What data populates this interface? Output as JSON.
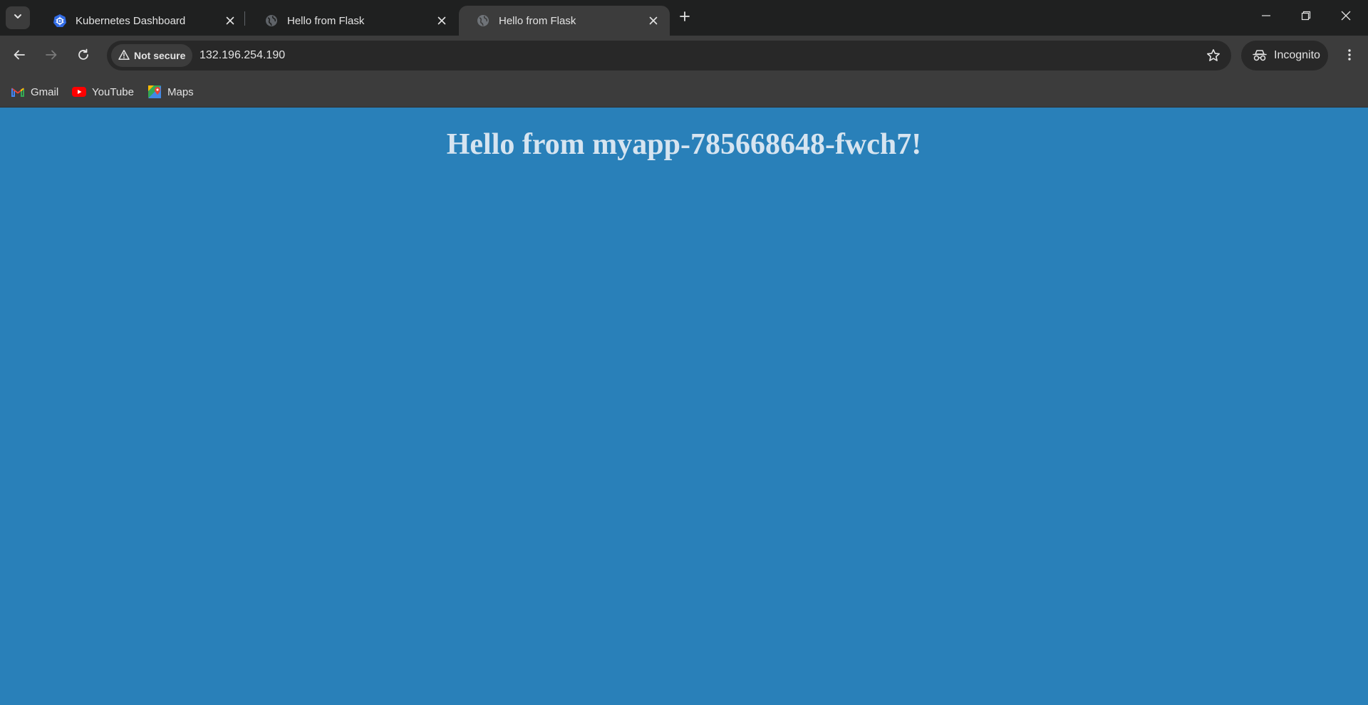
{
  "browser": {
    "tabs": [
      {
        "title": "Kubernetes Dashboard",
        "favicon": "kubernetes-icon",
        "active": false
      },
      {
        "title": "Hello from Flask",
        "favicon": "globe-icon",
        "active": false
      },
      {
        "title": "Hello from Flask",
        "favicon": "globe-icon",
        "active": true
      }
    ],
    "address_bar": {
      "security_label": "Not secure",
      "url": "132.196.254.190"
    },
    "profile_label": "Incognito",
    "bookmarks": [
      {
        "label": "Gmail",
        "icon": "gmail-icon"
      },
      {
        "label": "YouTube",
        "icon": "youtube-icon"
      },
      {
        "label": "Maps",
        "icon": "maps-icon"
      }
    ]
  },
  "page": {
    "heading": "Hello from myapp-785668648-fwch7!",
    "background_color": "#2980b9",
    "heading_color": "#d6e4f0"
  }
}
